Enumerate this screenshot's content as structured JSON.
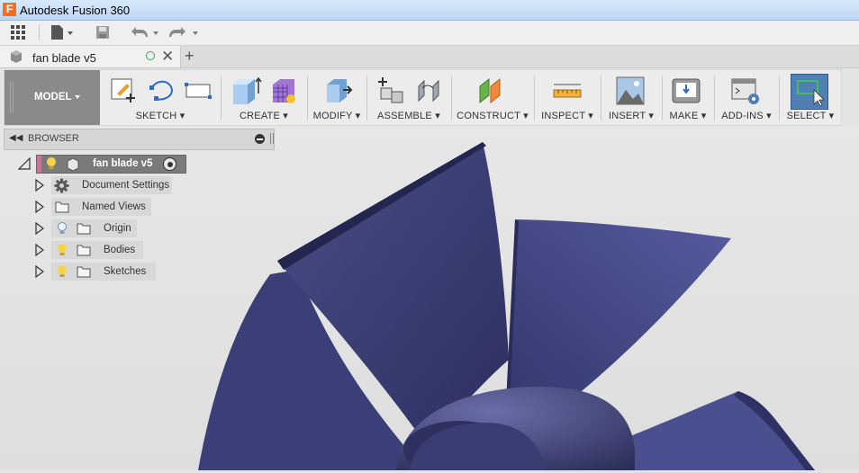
{
  "window": {
    "title": "Autodesk Fusion 360",
    "logo": "F"
  },
  "document": {
    "tab_title": "fan blade v5",
    "new_tab": "+"
  },
  "toolbar": {
    "workspace": "MODEL",
    "groups": [
      {
        "label": "SKETCH"
      },
      {
        "label": "CREATE"
      },
      {
        "label": "MODIFY"
      },
      {
        "label": "ASSEMBLE"
      },
      {
        "label": "CONSTRUCT"
      },
      {
        "label": "INSPECT"
      },
      {
        "label": "INSERT"
      },
      {
        "label": "MAKE"
      },
      {
        "label": "ADD-INS"
      },
      {
        "label": "SELECT"
      }
    ]
  },
  "browser": {
    "title": "BROWSER",
    "root": "fan blade v5",
    "items": [
      {
        "label": "Document Settings",
        "icon": "gear-icon"
      },
      {
        "label": "Named Views",
        "icon": "folder-icon"
      },
      {
        "label": "Origin",
        "icon": "lightbulb-off-icon"
      },
      {
        "label": "Bodies",
        "icon": "lightbulb-on-icon"
      },
      {
        "label": "Sketches",
        "icon": "lightbulb-on-icon"
      }
    ]
  },
  "colors": {
    "blade": "#3f4379",
    "workspace": "#8a8a8a",
    "select_active": "#4f7fb3",
    "accent": "#f37021"
  }
}
